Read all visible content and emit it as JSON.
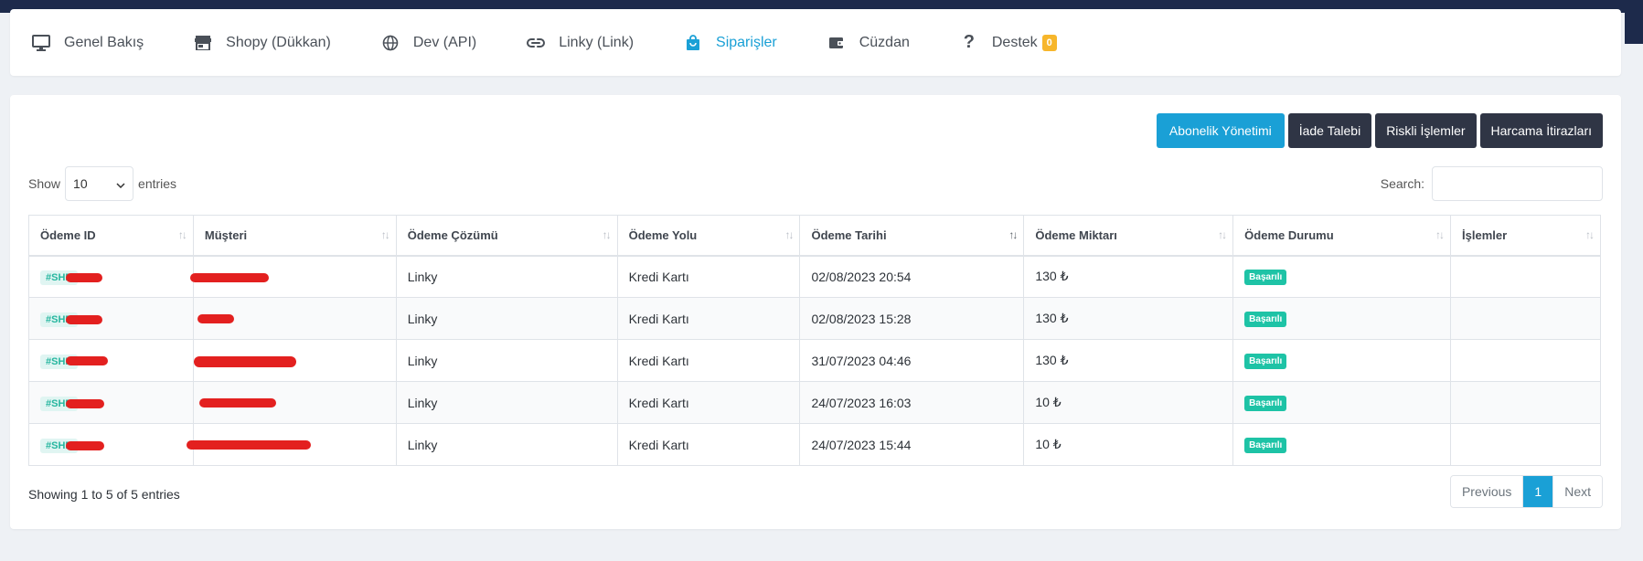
{
  "nav": {
    "items": [
      {
        "label": "Genel Bakış",
        "icon": "monitor-icon"
      },
      {
        "label": "Shopy (Dükkan)",
        "icon": "store-icon"
      },
      {
        "label": "Dev (API)",
        "icon": "globe-icon"
      },
      {
        "label": "Linky (Link)",
        "icon": "link-icon"
      },
      {
        "label": "Siparişler",
        "icon": "shopping-bag-icon"
      },
      {
        "label": "Cüzdan",
        "icon": "wallet-icon"
      },
      {
        "label": "Destek",
        "icon": "question-icon",
        "badge": "0"
      }
    ],
    "active_color": "#1aa0d6"
  },
  "actions": {
    "subscription": "Abonelik Yönetimi",
    "refund": "İade Talebi",
    "risky": "Riskli İşlemler",
    "disputes": "Harcama İtirazları"
  },
  "table_controls": {
    "show_label": "Show",
    "entries_value": "10",
    "entries_label": "entries",
    "search_label": "Search:"
  },
  "table": {
    "headers": [
      "Ödeme ID",
      "Müşteri",
      "Ödeme Çözümü",
      "Ödeme Yolu",
      "Ödeme Tarihi",
      "Ödeme Miktarı",
      "Ödeme Durumu",
      "İşlemler"
    ],
    "rows": [
      {
        "id": "#SHP",
        "customer": "",
        "solution": "Linky",
        "method": "Kredi Kartı",
        "date": "02/08/2023 20:54",
        "amount": "130 ₺",
        "status": "Başarılı"
      },
      {
        "id": "#SHP",
        "customer": "",
        "solution": "Linky",
        "method": "Kredi Kartı",
        "date": "02/08/2023 15:28",
        "amount": "130 ₺",
        "status": "Başarılı"
      },
      {
        "id": "#SHP",
        "customer": "",
        "solution": "Linky",
        "method": "Kredi Kartı",
        "date": "31/07/2023 04:46",
        "amount": "130 ₺",
        "status": "Başarılı"
      },
      {
        "id": "#SHP",
        "customer": "",
        "solution": "Linky",
        "method": "Kredi Kartı",
        "date": "24/07/2023 16:03",
        "amount": "10 ₺",
        "status": "Başarılı"
      },
      {
        "id": "#SHP",
        "customer": "",
        "solution": "Linky",
        "method": "Kredi Kartı",
        "date": "24/07/2023 15:44",
        "amount": "10 ₺",
        "status": "Başarılı"
      }
    ]
  },
  "footer": {
    "info": "Showing 1 to 5 of 5 entries",
    "previous": "Previous",
    "page": "1",
    "next": "Next"
  },
  "colors": {
    "primary": "#1aa0d6",
    "dark": "#2f3545",
    "success": "#1ec3a6",
    "warning": "#f7b62b",
    "redaction": "#e3201f"
  }
}
